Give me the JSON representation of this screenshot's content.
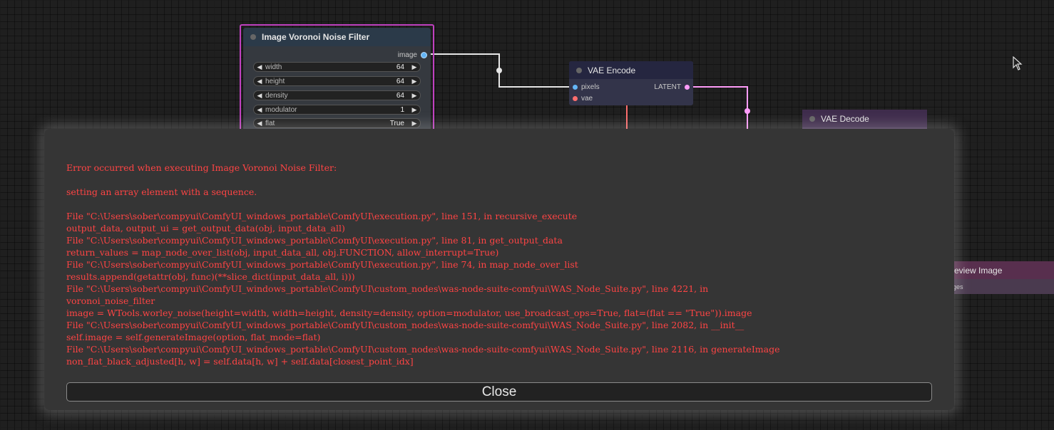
{
  "nodes": {
    "voronoi": {
      "title": "Image Voronoi Noise Filter",
      "output_label": "image",
      "widgets": [
        {
          "label": "width",
          "value": "64"
        },
        {
          "label": "height",
          "value": "64"
        },
        {
          "label": "density",
          "value": "64"
        },
        {
          "label": "modulator",
          "value": "1"
        },
        {
          "label": "flat",
          "value": "True"
        }
      ]
    },
    "vae_encode": {
      "title": "VAE Encode",
      "inputs": [
        "pixels",
        "vae"
      ],
      "output_label": "LATENT"
    },
    "vae_decode": {
      "title": "VAE Decode"
    },
    "preview_image": {
      "title": "review Image",
      "input_label": "iges"
    }
  },
  "error_dialog": {
    "lines": [
      "Error occurred when executing Image Voronoi Noise Filter:",
      "",
      "setting an array element with a sequence.",
      "",
      "File \"C:\\Users\\sober\\compyui\\ComfyUI_windows_portable\\ComfyUI\\execution.py\", line 151, in recursive_execute",
      "output_data, output_ui = get_output_data(obj, input_data_all)",
      "File \"C:\\Users\\sober\\compyui\\ComfyUI_windows_portable\\ComfyUI\\execution.py\", line 81, in get_output_data",
      "return_values = map_node_over_list(obj, input_data_all, obj.FUNCTION, allow_interrupt=True)",
      "File \"C:\\Users\\sober\\compyui\\ComfyUI_windows_portable\\ComfyUI\\execution.py\", line 74, in map_node_over_list",
      "results.append(getattr(obj, func)(**slice_dict(input_data_all, i)))",
      "File \"C:\\Users\\sober\\compyui\\ComfyUI_windows_portable\\ComfyUI\\custom_nodes\\was-node-suite-comfyui\\WAS_Node_Suite.py\", line 4221, in",
      "voronoi_noise_filter",
      "image = WTools.worley_noise(height=width, width=height, density=density, option=modulator, use_broadcast_ops=True, flat=(flat == \"True\")).image",
      "File \"C:\\Users\\sober\\compyui\\ComfyUI_windows_portable\\ComfyUI\\custom_nodes\\was-node-suite-comfyui\\WAS_Node_Suite.py\", line 2082, in __init__",
      "self.image = self.generateImage(option, flat_mode=flat)",
      "File \"C:\\Users\\sober\\compyui\\ComfyUI_windows_portable\\ComfyUI\\custom_nodes\\was-node-suite-comfyui\\WAS_Node_Suite.py\", line 2116, in generateImage",
      "non_flat_black_adjusted[h, w] = self.data[h, w] + self.data[closest_point_idx]"
    ],
    "close_label": "Close"
  },
  "colors": {
    "error_text": "#ff4444",
    "latent_link": "#ff9cf9",
    "image_link": "#e6e6e6",
    "vae_link": "#ff6e6e",
    "selected_outline": "#c040c0"
  },
  "icons": {
    "cursor": "arrow-cursor-icon"
  }
}
